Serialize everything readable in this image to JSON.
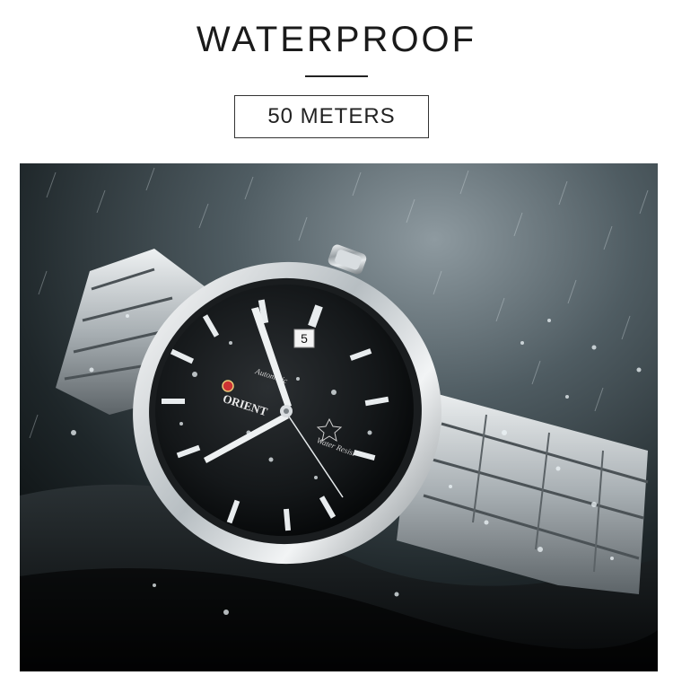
{
  "heading": {
    "title": "WATERPROOF",
    "subtitle": "50 METERS"
  },
  "photo": {
    "dial_brand": "ORIENT",
    "dial_script": "Automatic",
    "dial_script_2": "Water Resist",
    "date_window": "5"
  }
}
